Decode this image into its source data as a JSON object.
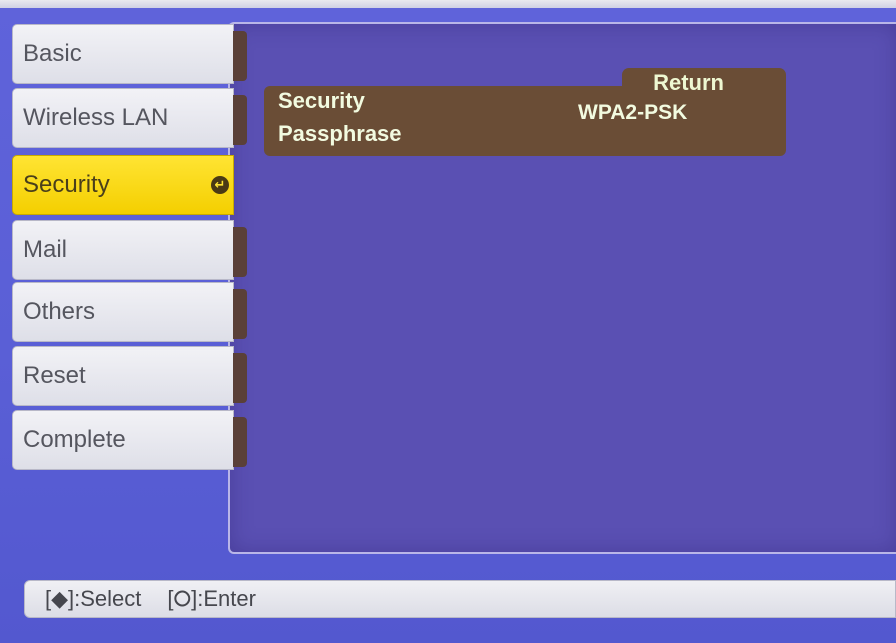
{
  "menu": {
    "items": [
      {
        "label": "Basic"
      },
      {
        "label": "Wireless LAN"
      },
      {
        "label": "Security",
        "active": true
      },
      {
        "label": "Mail"
      },
      {
        "label": "Others"
      },
      {
        "label": "Reset"
      },
      {
        "label": "Complete"
      }
    ],
    "enter_icon": "enter-icon"
  },
  "settings": {
    "return_label": "Return",
    "security_label": "Security",
    "security_value": "WPA2-PSK",
    "passphrase_label": "Passphrase"
  },
  "help": {
    "select": "[◆]:Select",
    "enter": "[⭘]:Enter"
  },
  "colors": {
    "background": "#5a5fd6",
    "panel": "#5a50b3",
    "active_tab": "#f4cf00",
    "setting_band": "#6a4d36"
  }
}
